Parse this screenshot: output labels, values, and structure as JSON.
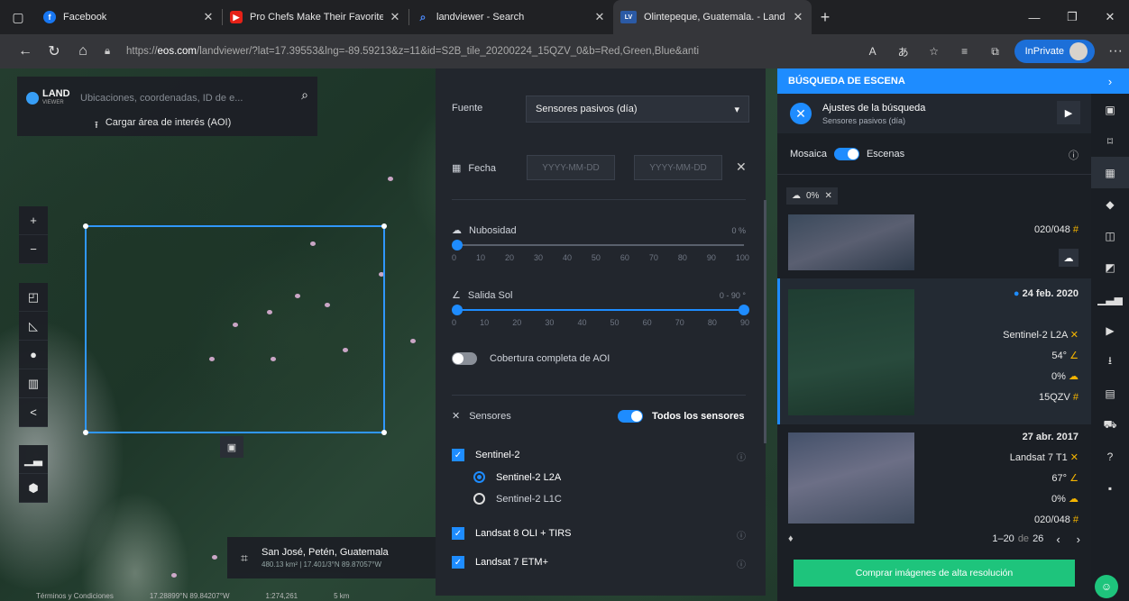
{
  "browser": {
    "tabs": [
      {
        "title": "Facebook",
        "icon_color": "#1877f2",
        "icon_glyph": "f",
        "active": false
      },
      {
        "title": "Pro Chefs Make Their Favorite S",
        "icon_color": "#e62117",
        "icon_glyph": "▶",
        "active": false
      },
      {
        "title": "landviewer - Search",
        "icon_color": "#2f5fd1",
        "icon_glyph": "⌕",
        "active": false
      },
      {
        "title": "Olintepeque, Guatemala. - Land",
        "icon_color": "#2b5aa5",
        "icon_glyph": "LV",
        "active": true
      }
    ],
    "url_prefix": "https://",
    "url_domain": "eos.com",
    "url_rest": "/landviewer/?lat=17.39553&lng=-89.59213&z=11&id=S2B_tile_20200224_15QZV_0&b=Red,Green,Blue&anti",
    "inprivate_label": "InPrivate"
  },
  "map": {
    "search_placeholder": "Ubicaciones, coordenadas, ID de e...",
    "logo_top": "LAND",
    "logo_bottom": "VIEWER",
    "aoi_upload_label": "Cargar área de interés (AOI)",
    "location_name": "San José, Petén, Guatemala",
    "location_detail": "480.13 km² | 17.401/3°N 89.87057°W",
    "footer_terms": "Términos y Condiciones",
    "footer_coords": "17.28899°N 89.84207°W",
    "footer_scale": "1:274,261",
    "footer_km": "5 km"
  },
  "filters": {
    "source_label": "Fuente",
    "source_value": "Sensores pasivos (día)",
    "date_label": "Fecha",
    "date_from_placeholder": "YYYY-MM-DD",
    "date_to_placeholder": "YYYY-MM-DD",
    "cloud_label": "Nubosidad",
    "cloud_value": "0 %",
    "cloud_ticks": [
      "0",
      "10",
      "20",
      "30",
      "40",
      "50",
      "60",
      "70",
      "80",
      "90",
      "100"
    ],
    "cloud_fraction": 0,
    "sun_label": "Salida Sol",
    "sun_value": "0 - 90 °",
    "sun_ticks": [
      "0",
      "10",
      "20",
      "30",
      "40",
      "50",
      "60",
      "70",
      "80",
      "90"
    ],
    "sun_fraction": 1,
    "full_cover_label": "Cobertura completa de AOI",
    "sensors_label": "Sensores",
    "all_sensors_label": "Todos los sensores",
    "sentinel2_label": "Sentinel-2",
    "s2_l2a_label": "Sentinel-2 L2A",
    "s2_l1c_label": "Sentinel-2 L1C",
    "landsat8_label": "Landsat 8 OLI + TIRS",
    "landsat7_label": "Landsat 7 ETM+"
  },
  "scenes": {
    "header_title": "BÚSQUEDA DE ESCENA",
    "settings_title": "Ajustes de la búsqueda",
    "settings_subtitle": "Sensores pasivos (día)",
    "mosaic_label": "Mosaica",
    "scenes_label": "Escenas",
    "cloud_chip": "0%",
    "card1_tile": "020/048",
    "card2_date": "24 feb. 2020",
    "card2_sensor": "Sentinel-2  L2A",
    "card2_sun": "54°",
    "card2_cloud": "0%",
    "card2_tile": "15QZV",
    "card3_date": "27 abr. 2017",
    "card3_sensor": "Landsat  7  T1",
    "card3_sun": "67°",
    "card3_cloud": "0%",
    "card3_tile": "020/048",
    "pager_range": "1–20",
    "pager_of": "de",
    "pager_total": "26",
    "buy_label": "Comprar imágenes de alta resolución"
  },
  "colors": {
    "accent": "#1e8cff",
    "green": "#1ec47c",
    "panel": "#22262d"
  }
}
